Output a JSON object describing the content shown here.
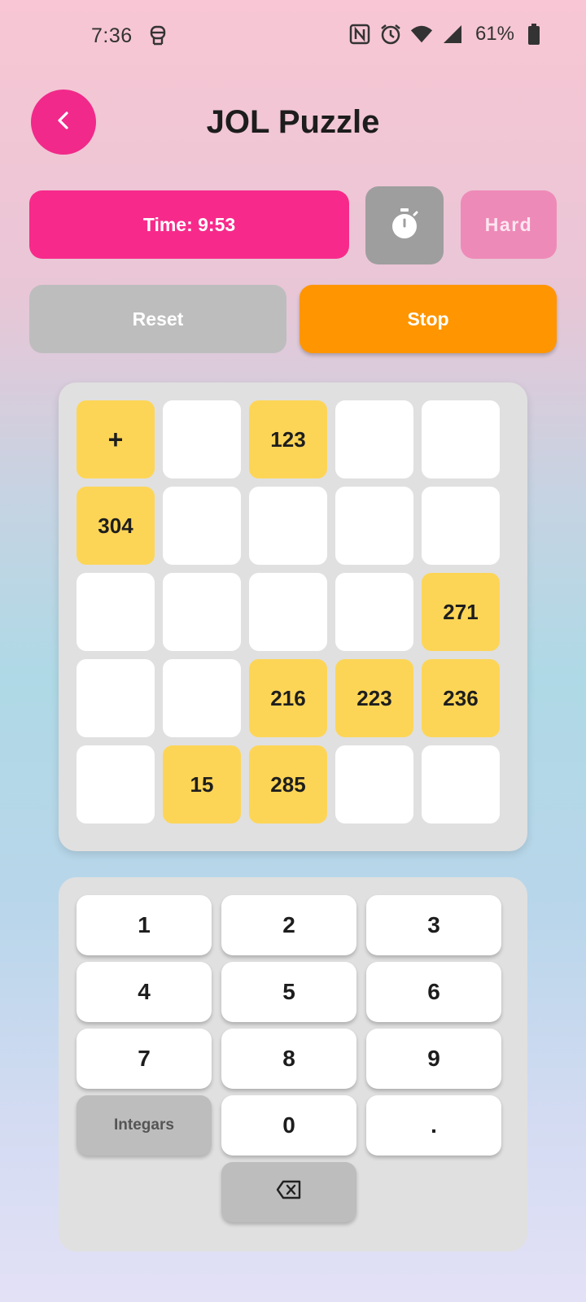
{
  "status": {
    "time": "7:36",
    "battery": "61%"
  },
  "header": {
    "title": "JOL Puzzle"
  },
  "controls": {
    "timer_label": "Time: 9:53",
    "difficulty": "Hard",
    "reset_label": "Reset",
    "stop_label": "Stop"
  },
  "grid": {
    "rows": [
      [
        {
          "v": "+",
          "f": true,
          "op": true
        },
        {
          "v": "",
          "f": false
        },
        {
          "v": "123",
          "f": true
        },
        {
          "v": "",
          "f": false
        },
        {
          "v": "",
          "f": false
        }
      ],
      [
        {
          "v": "304",
          "f": true
        },
        {
          "v": "",
          "f": false
        },
        {
          "v": "",
          "f": false
        },
        {
          "v": "",
          "f": false
        },
        {
          "v": "",
          "f": false
        }
      ],
      [
        {
          "v": "",
          "f": false
        },
        {
          "v": "",
          "f": false
        },
        {
          "v": "",
          "f": false
        },
        {
          "v": "",
          "f": false
        },
        {
          "v": "271",
          "f": true
        }
      ],
      [
        {
          "v": "",
          "f": false
        },
        {
          "v": "",
          "f": false
        },
        {
          "v": "216",
          "f": true
        },
        {
          "v": "223",
          "f": true
        },
        {
          "v": "236",
          "f": true
        }
      ],
      [
        {
          "v": "",
          "f": false
        },
        {
          "v": "15",
          "f": true
        },
        {
          "v": "285",
          "f": true
        },
        {
          "v": "",
          "f": false
        },
        {
          "v": "",
          "f": false
        }
      ]
    ]
  },
  "keypad": {
    "keys": [
      {
        "label": "1"
      },
      {
        "label": "2"
      },
      {
        "label": "3"
      },
      {
        "label": "4"
      },
      {
        "label": "5"
      },
      {
        "label": "6"
      },
      {
        "label": "7"
      },
      {
        "label": "8"
      },
      {
        "label": "9"
      },
      {
        "label": "Integars",
        "gray": true
      },
      {
        "label": "0"
      },
      {
        "label": "."
      },
      {
        "label": "",
        "gray": true,
        "icon": "backspace-icon"
      }
    ]
  },
  "colors": {
    "accent": "#f72a8b",
    "cell_filled": "#fdd556",
    "stop": "#ff9500",
    "neutral": "#bdbdbd"
  }
}
